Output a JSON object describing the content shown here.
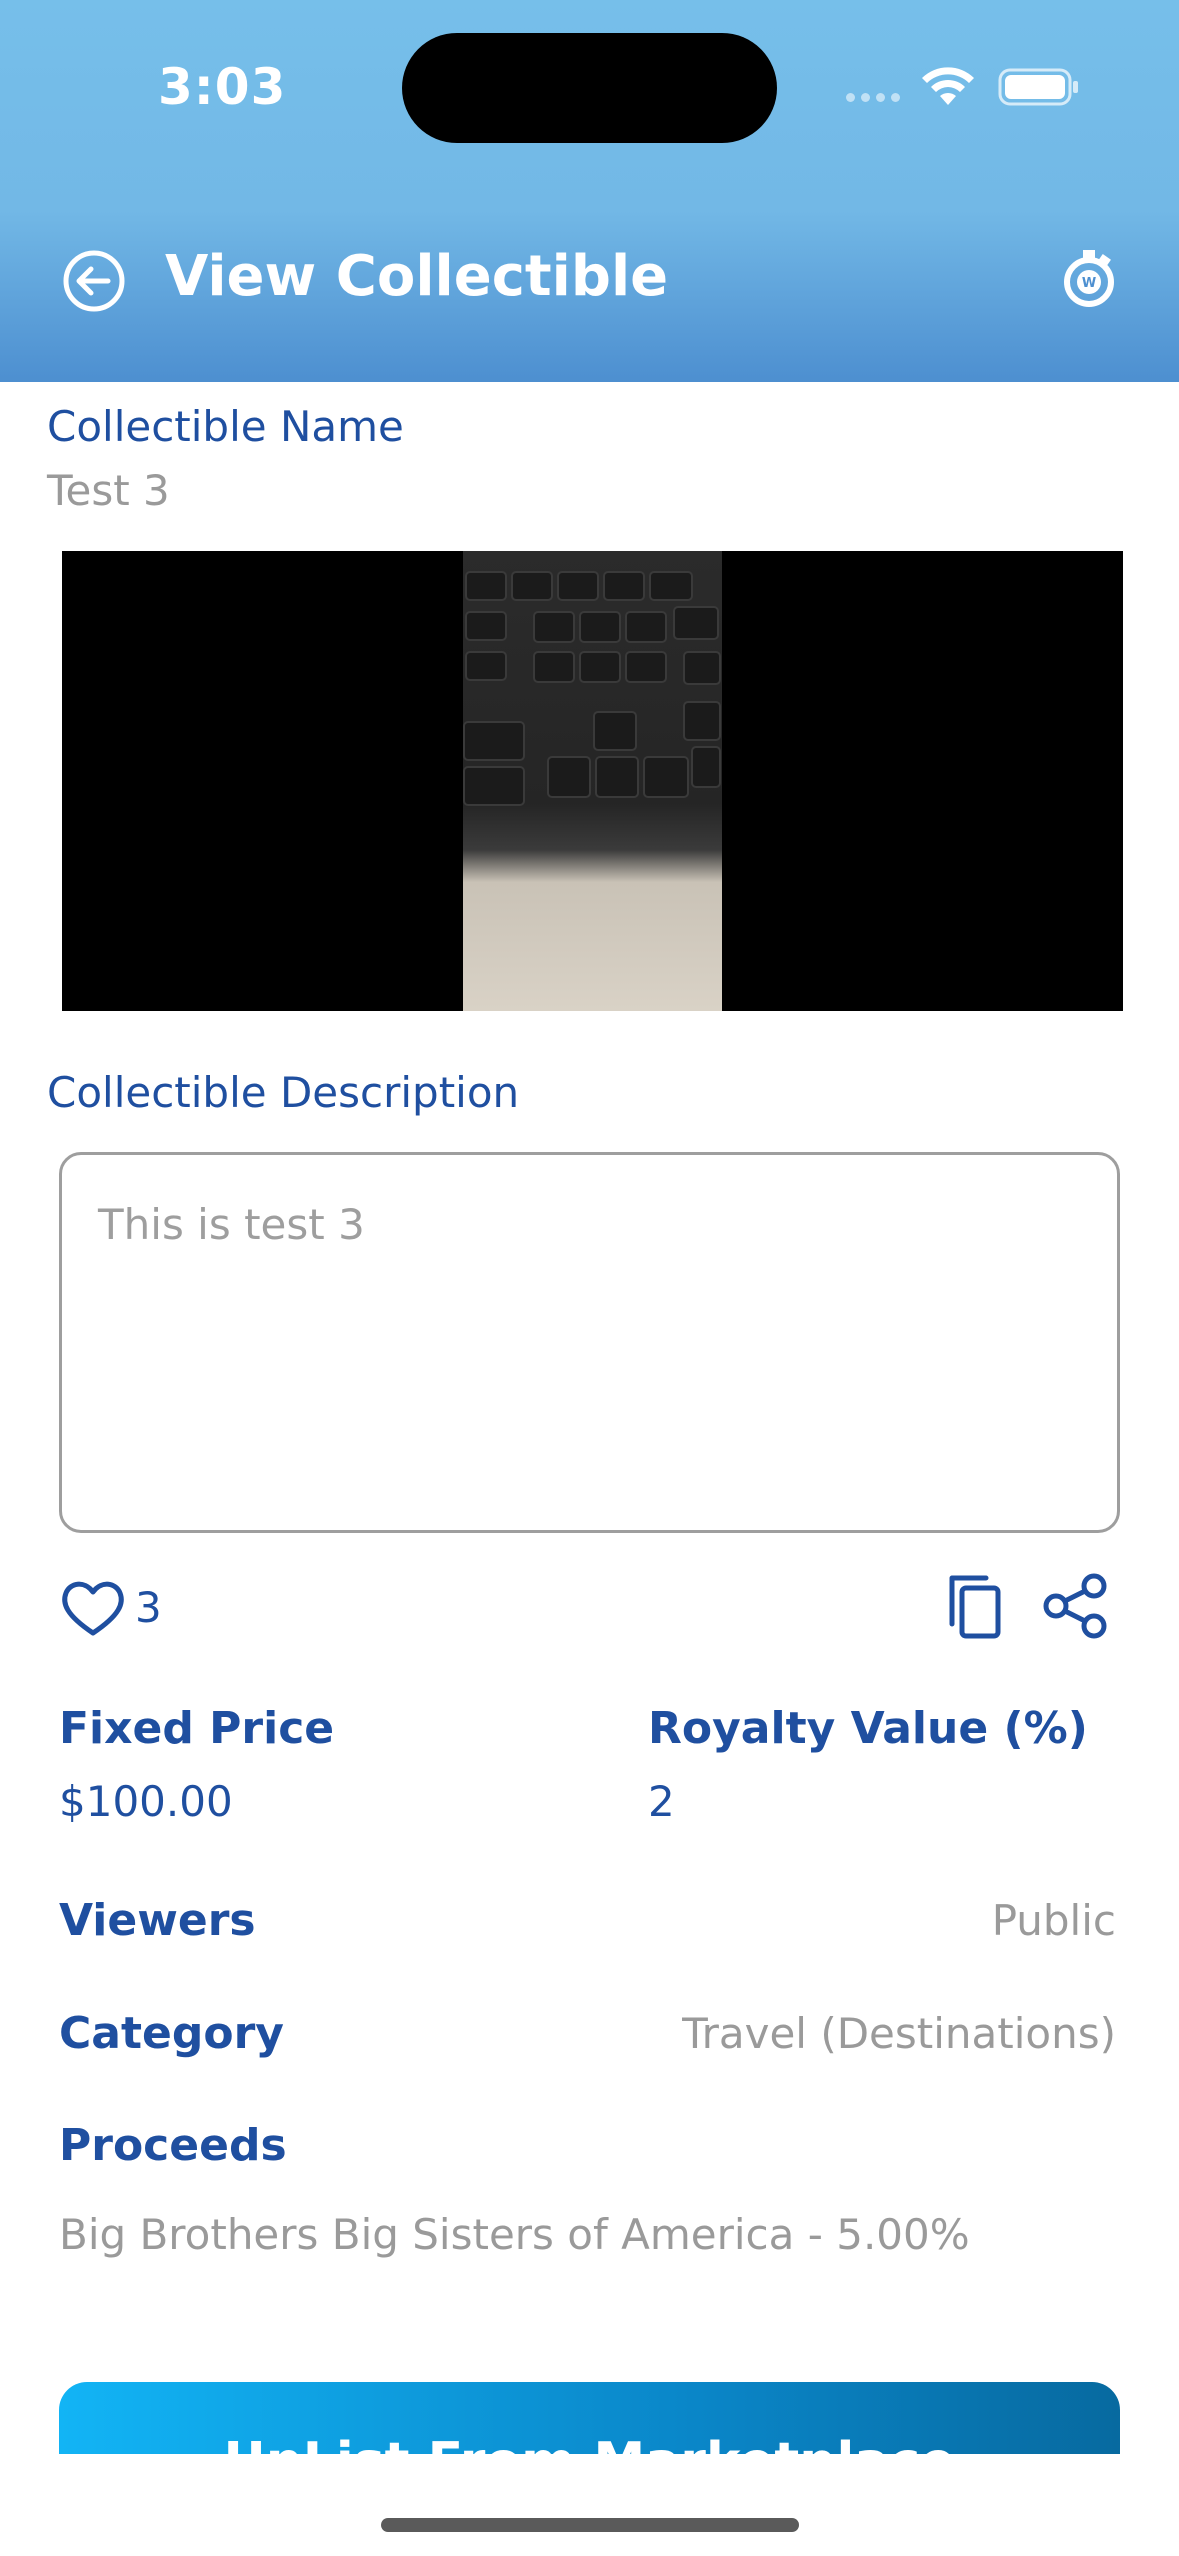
{
  "status_bar": {
    "time": "3:03"
  },
  "header": {
    "title": "View Collectible"
  },
  "collectible": {
    "name_label": "Collectible Name",
    "name_value": "Test 3",
    "description_label": "Collectible Description",
    "description_value": "This is test 3",
    "likes": "3"
  },
  "details": {
    "fixed_price_label": "Fixed Price",
    "fixed_price_value": "$100.00",
    "royalty_label": "Royalty Value (%)",
    "royalty_value": "2",
    "viewers_label": "Viewers",
    "viewers_value": "Public",
    "category_label": "Category",
    "category_value": "Travel (Destinations)",
    "proceeds_label": "Proceeds",
    "proceeds_value": "Big Brothers Big Sisters of America - 5.00%"
  },
  "actions": {
    "unlist_label": "UnList From Marketplace"
  },
  "colors": {
    "accent_blue": "#1f4fa0",
    "header_top": "#76bfea",
    "header_bottom": "#4d8fd0",
    "button_start": "#12b4f5",
    "button_end": "#076aa0"
  },
  "icons": [
    "back-arrow-icon",
    "wallet-logo-icon",
    "heart-icon",
    "copy-icon",
    "share-icon",
    "wifi-icon",
    "battery-icon"
  ]
}
